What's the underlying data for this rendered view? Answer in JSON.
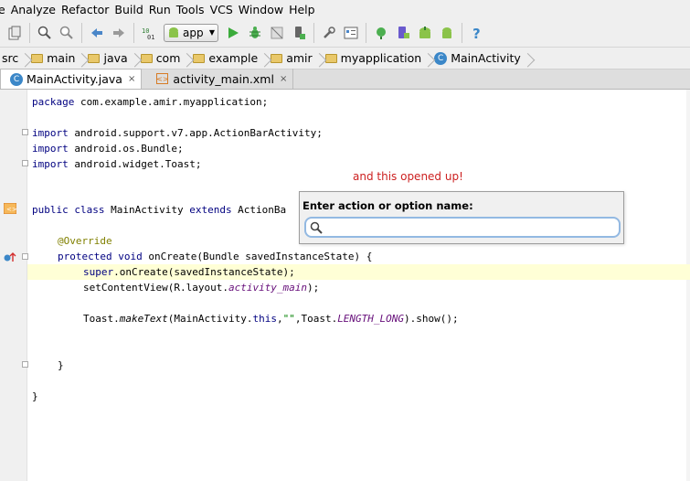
{
  "menu": [
    "e",
    "Analyze",
    "Refactor",
    "Build",
    "Run",
    "Tools",
    "VCS",
    "Window",
    "Help"
  ],
  "toolbar": {
    "run_config": "app"
  },
  "breadcrumb": [
    "src",
    "main",
    "java",
    "com",
    "example",
    "amir",
    "myapplication",
    "MainActivity"
  ],
  "tabs": [
    {
      "label": "MainActivity.java",
      "close": "×"
    },
    {
      "label": "activity_main.xml",
      "close": "×"
    }
  ],
  "code": {
    "l1_kw": "package",
    "l1_rest": " com.example.amir.myapplication;",
    "l3_kw": "import",
    "l3_rest": " android.support.v7.app.ActionBarActivity;",
    "l4_kw": "import",
    "l4_rest": " android.os.Bundle;",
    "l5_kw": "import",
    "l5_rest": " android.widget.Toast;",
    "l8_kw1": "public class",
    "l8_mid": " MainActivity ",
    "l8_kw2": "extends",
    "l8_rest": " ActionBa",
    "l10_ann": "@Override",
    "l11_kw": "protected void",
    "l11_rest": " onCreate(Bundle savedInstanceState) {",
    "l12_kw": "super",
    "l12_rest": ".onCreate(savedInstanceState);",
    "l13_a": "setContentView(R.layout.",
    "l13_it": "activity_main",
    "l13_b": ");",
    "l15_a": "Toast.",
    "l15_it": "makeText",
    "l15_b": "(MainActivity.",
    "l15_kw": "this",
    "l15_c": ",",
    "l15_str": "\"\"",
    "l15_d": ",Toast.",
    "l15_const": "LENGTH_LONG",
    "l15_e": ").show();",
    "l18": "}",
    "l20": "}"
  },
  "annotation_note": "and this opened up!",
  "popup": {
    "title": "Enter action or option name:",
    "value": ""
  }
}
